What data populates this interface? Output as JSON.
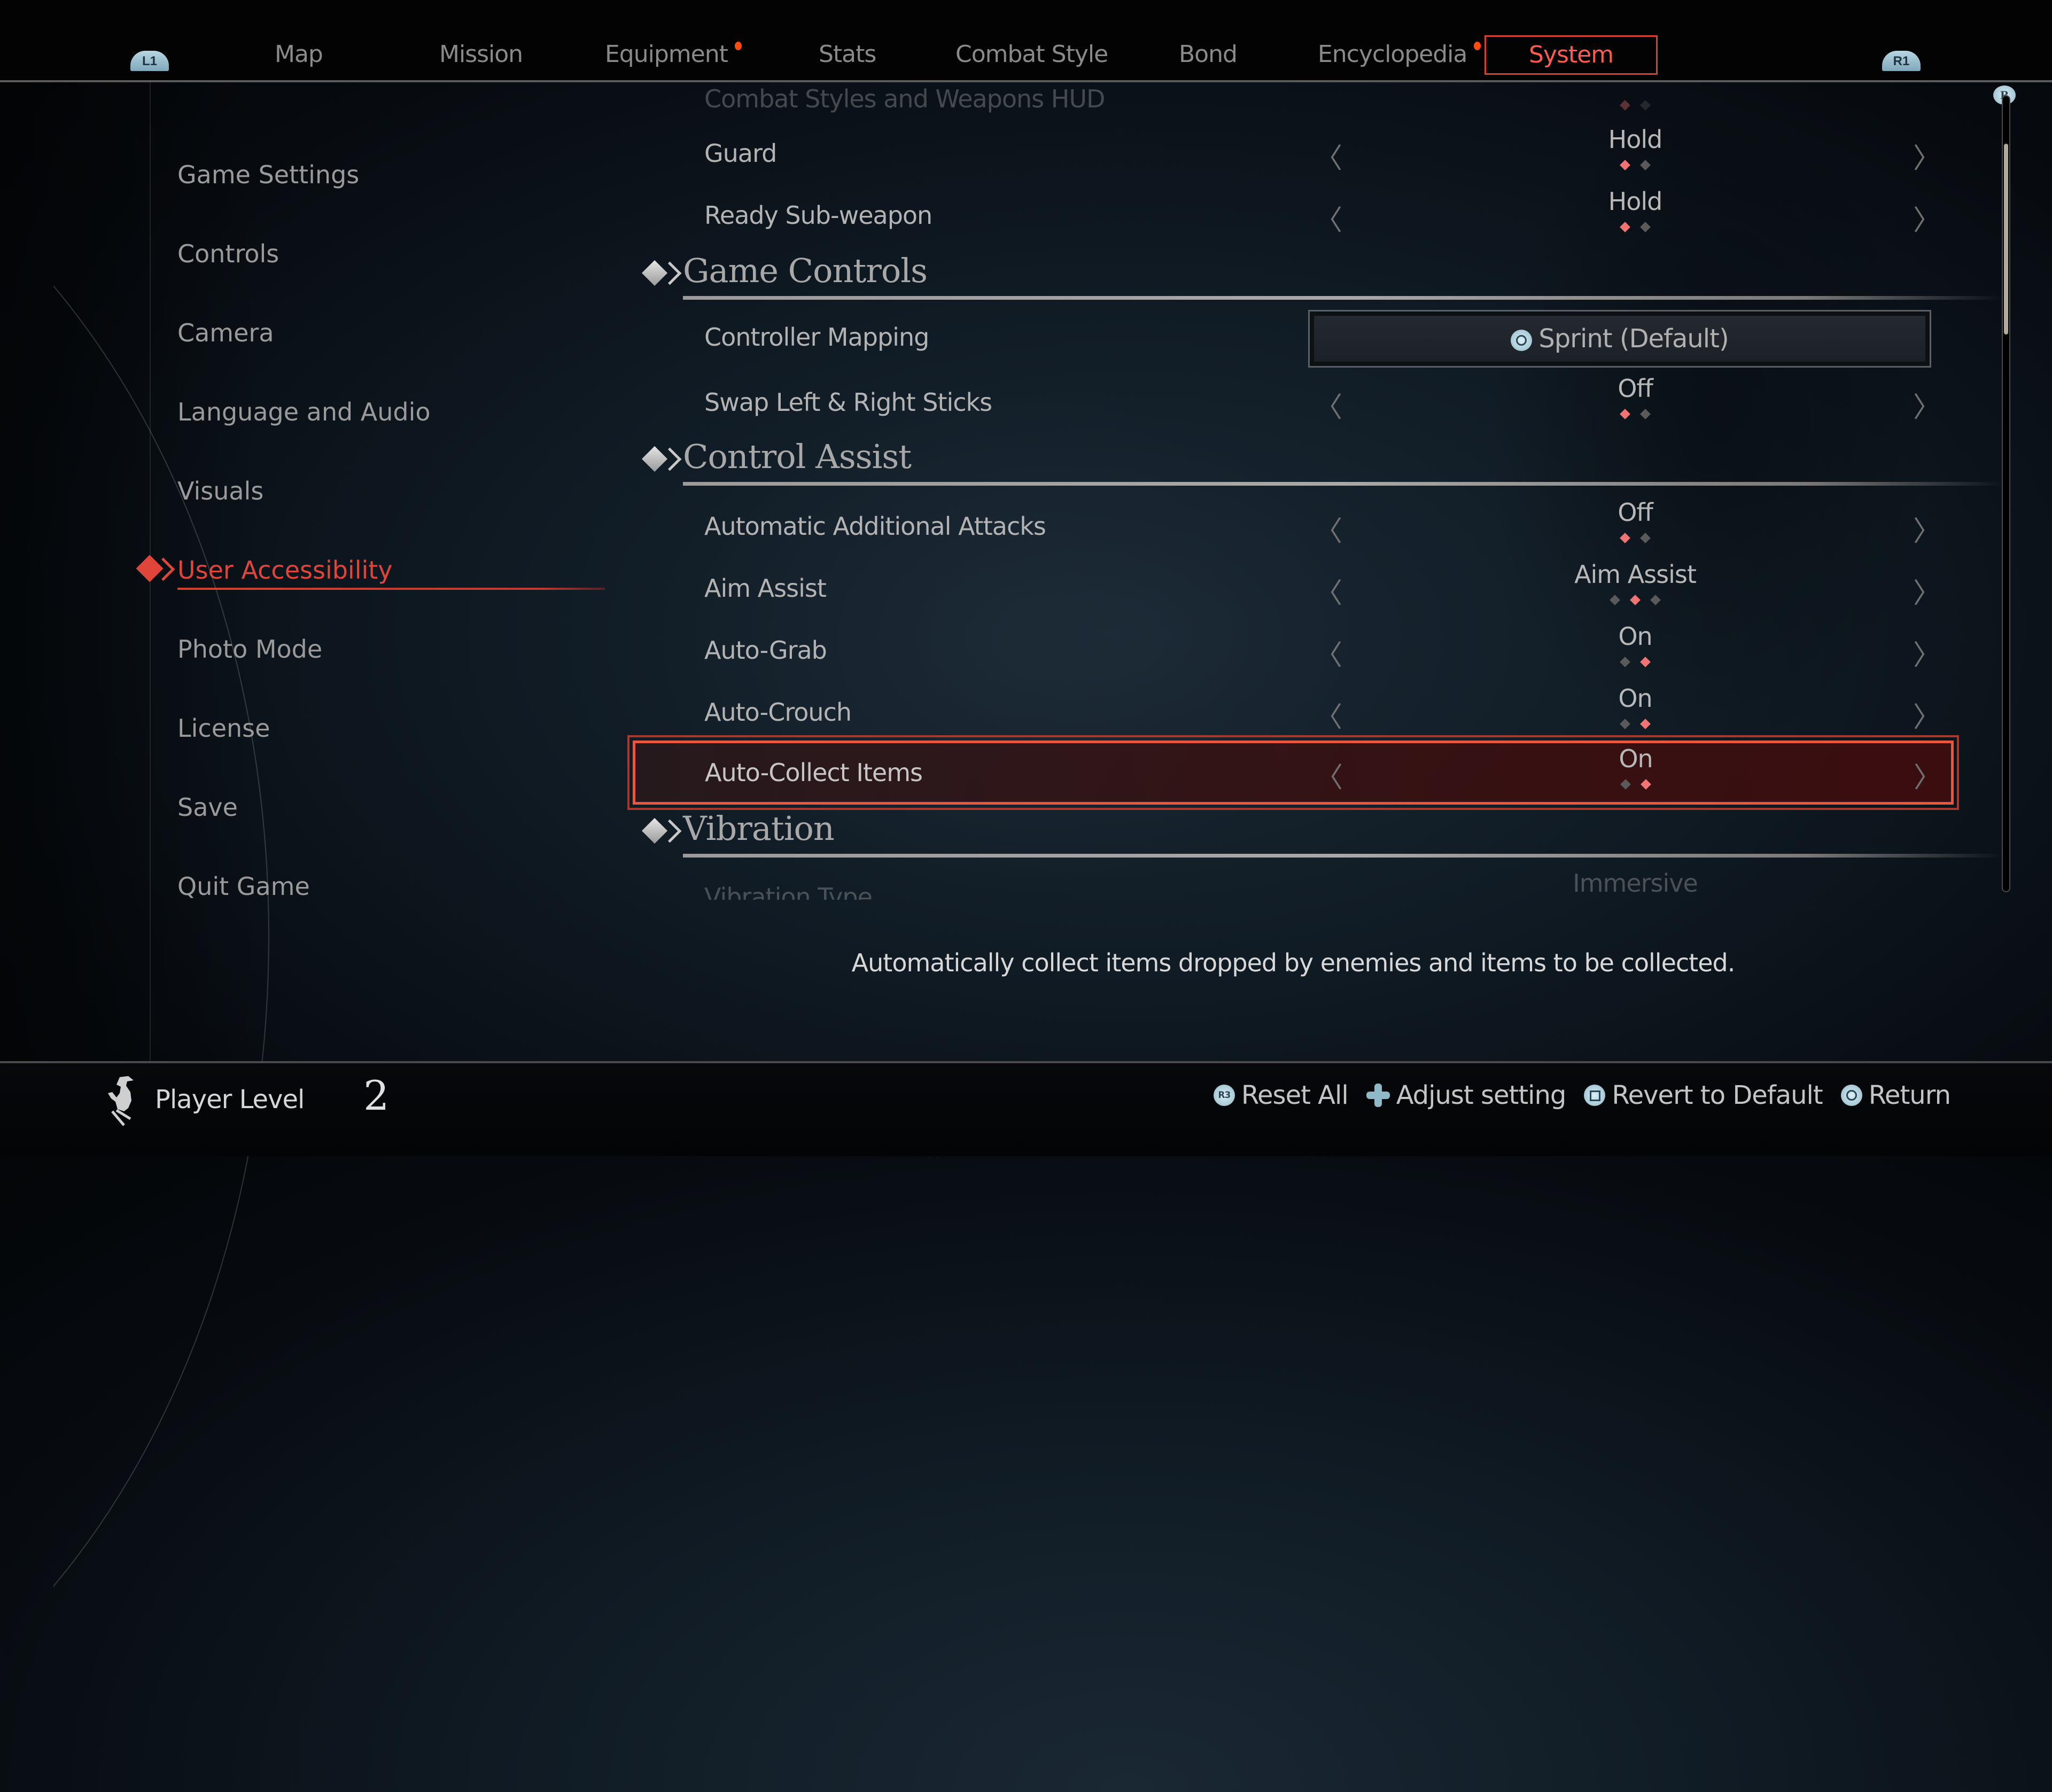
{
  "top_nav": {
    "left_shoulder": "L1",
    "right_shoulder": "R1",
    "tabs": [
      {
        "label": "Map",
        "notify": false,
        "active": false
      },
      {
        "label": "Mission",
        "notify": false,
        "active": false
      },
      {
        "label": "Equipment",
        "notify": true,
        "active": false
      },
      {
        "label": "Stats",
        "notify": false,
        "active": false
      },
      {
        "label": "Combat Style",
        "notify": false,
        "active": false
      },
      {
        "label": "Bond",
        "notify": false,
        "active": false
      },
      {
        "label": "Encyclopedia",
        "notify": true,
        "active": false
      },
      {
        "label": "System",
        "notify": false,
        "active": true
      }
    ]
  },
  "sidebar": {
    "items": [
      {
        "label": "Game Settings"
      },
      {
        "label": "Controls"
      },
      {
        "label": "Camera"
      },
      {
        "label": "Language and Audio"
      },
      {
        "label": "Visuals"
      },
      {
        "label": "User Accessibility",
        "active": true
      },
      {
        "label": "Photo Mode"
      },
      {
        "label": "License"
      },
      {
        "label": "Save"
      },
      {
        "label": "Quit Game"
      }
    ]
  },
  "settings": {
    "partial_top": {
      "label": "Combat Styles and Weapons HUD",
      "option_count": 2,
      "selected_index": 0
    },
    "rows_top": [
      {
        "label": "Guard",
        "value": "Hold",
        "option_count": 2,
        "selected_index": 0
      },
      {
        "label": "Ready Sub-weapon",
        "value": "Hold",
        "option_count": 2,
        "selected_index": 0
      }
    ],
    "sections": {
      "game_controls": {
        "title": "Game Controls",
        "controller_mapping": {
          "label": "Controller Mapping",
          "button_icon": "circle-button-icon",
          "value": "Sprint (Default)"
        },
        "swap_sticks": {
          "label": "Swap Left & Right Sticks",
          "value": "Off",
          "option_count": 2,
          "selected_index": 0
        }
      },
      "control_assist": {
        "title": "Control Assist",
        "rows": [
          {
            "label": "Automatic Additional Attacks",
            "value": "Off",
            "option_count": 2,
            "selected_index": 0
          },
          {
            "label": "Aim Assist",
            "value": "Aim Assist",
            "option_count": 3,
            "selected_index": 1
          },
          {
            "label": "Auto-Grab",
            "value": "On",
            "option_count": 2,
            "selected_index": 1
          },
          {
            "label": "Auto-Crouch",
            "value": "On",
            "option_count": 2,
            "selected_index": 1
          },
          {
            "label": "Auto-Collect Items",
            "value": "On",
            "option_count": 2,
            "selected_index": 1,
            "selected": true
          }
        ]
      },
      "vibration": {
        "title": "Vibration",
        "partial_row": {
          "label": "Vibration Type",
          "value": "Immersive"
        }
      }
    },
    "arrow_left": "〈",
    "arrow_right": "〉"
  },
  "scrollbar": {
    "badge": "R",
    "thumb_start": 0.06,
    "thumb_fraction": 0.24
  },
  "description": "Automatically collect items dropped by enemies and items to be collected.",
  "footer": {
    "player_label": "Player Level",
    "player_level": "2",
    "hints": [
      {
        "icon": "r3-button-icon",
        "label": "Reset All"
      },
      {
        "icon": "dpad-icon",
        "label": "Adjust setting"
      },
      {
        "icon": "square-button-icon",
        "label": "Revert to Default"
      },
      {
        "icon": "circle-button-icon",
        "label": "Return"
      }
    ]
  },
  "colors": {
    "accent_red": "#e0453a",
    "pip_on": "#f07474",
    "pip_off": "#5a5a5a",
    "notify_dot": "#ff4a10",
    "button_blue": "#8fb8c8"
  }
}
